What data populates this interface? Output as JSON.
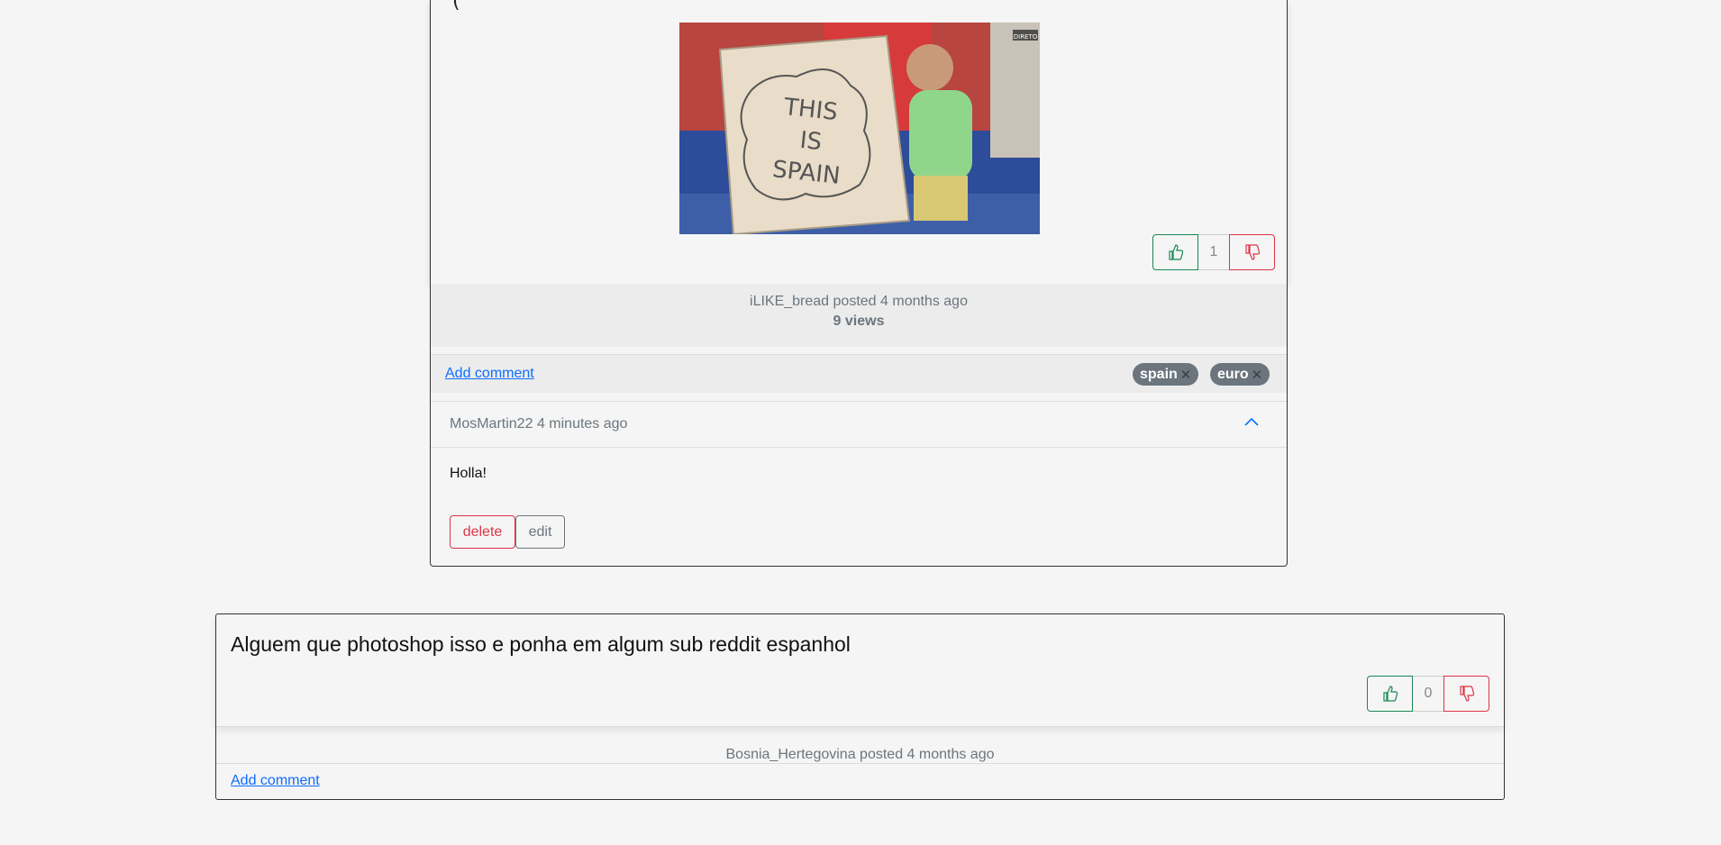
{
  "post1": {
    "image_text": [
      "THIS",
      "IS",
      "SPAIN"
    ],
    "image_badge": "DIRETO",
    "votes": 1,
    "author": "iLIKE_bread",
    "posted": "posted 4 months ago",
    "views": "9 views",
    "add_comment": "Add comment",
    "tags": [
      "spain",
      "euro"
    ],
    "comment": {
      "author": "MosMartin22",
      "time": "4 minutes ago",
      "text": "Holla!",
      "delete_label": "delete",
      "edit_label": "edit"
    }
  },
  "post2": {
    "title": "Alguem que photoshop isso e ponha em algum sub reddit espanhol",
    "votes": 0,
    "author": "Bosnia_Hertegovina",
    "posted": "posted 4 months ago",
    "add_comment": "Add comment"
  },
  "colors": {
    "upvote": "#198754",
    "downvote": "#dc3545",
    "link": "#0d6efd",
    "tag_bg": "#6c757d"
  }
}
